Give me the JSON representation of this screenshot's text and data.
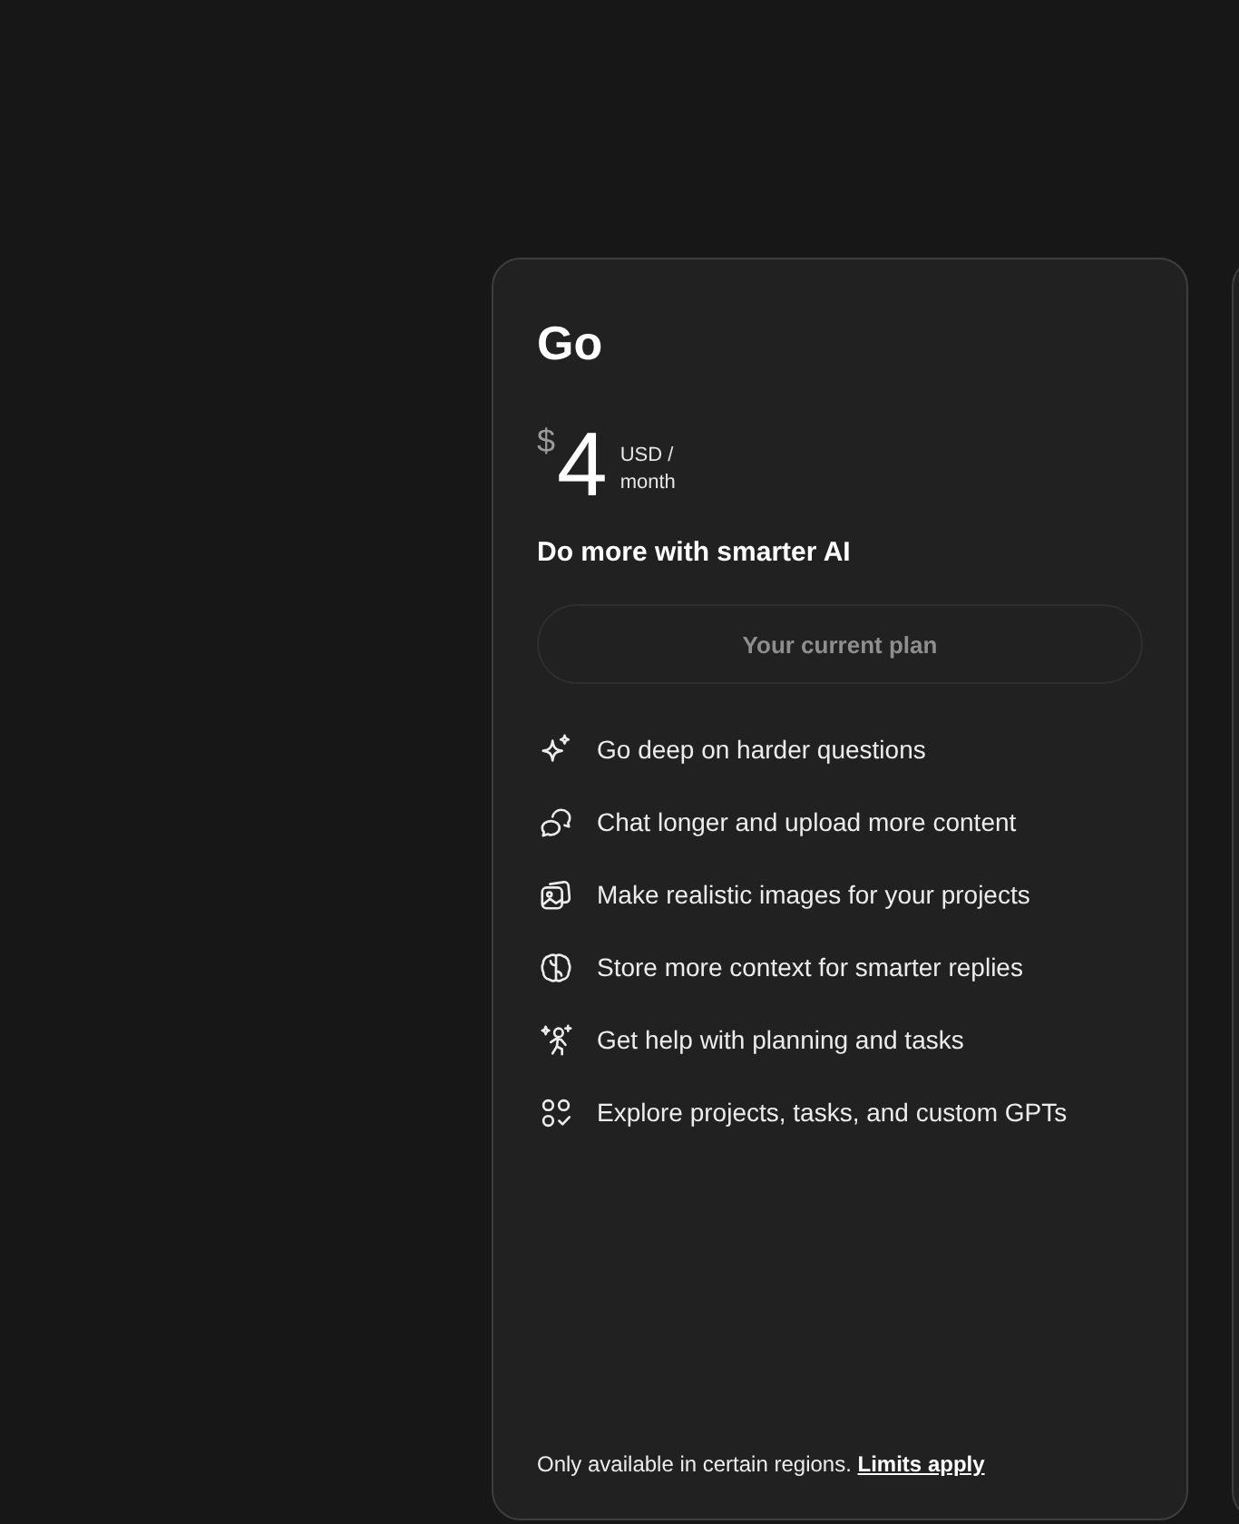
{
  "plan": {
    "name": "Go",
    "currency_symbol": "$",
    "price": "4",
    "price_unit": "USD / month",
    "tagline": "Do more with smarter AI",
    "button": {
      "label": "Your current plan",
      "disabled": true
    },
    "features": [
      "Go deep on harder questions",
      "Chat longer and upload more content",
      "Make realistic images for your projects",
      "Store more context for smarter replies",
      "Get help with planning and tasks",
      "Explore projects, tasks, and custom GPTs"
    ],
    "footer": {
      "text": "Only available in certain regions.",
      "link": "Limits apply"
    }
  }
}
